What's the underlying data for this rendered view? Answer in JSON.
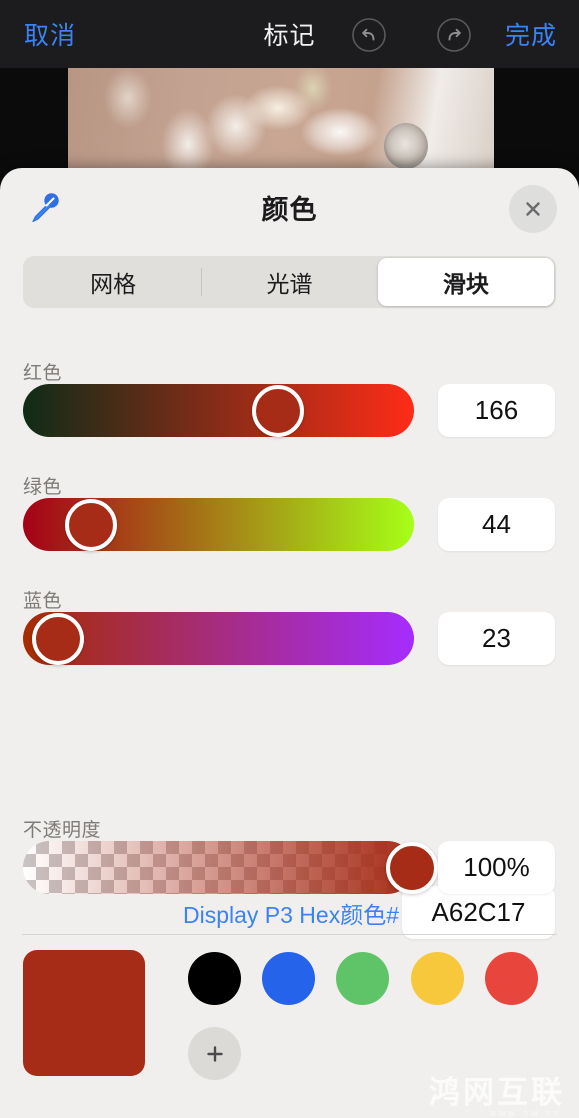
{
  "topbar": {
    "cancel_label": "取消",
    "title": "标记",
    "done_label": "完成",
    "undo_icon": "undo-arrow-icon",
    "redo_icon": "redo-arrow-icon"
  },
  "sheet": {
    "title": "颜色",
    "eyedropper_icon": "eyedropper-icon",
    "close_icon": "close-icon",
    "tabs": [
      {
        "label": "网格",
        "selected": false
      },
      {
        "label": "光谱",
        "selected": false
      },
      {
        "label": "滑块",
        "selected": true
      }
    ],
    "sliders": [
      {
        "name": "red",
        "label": "红色",
        "value": "166",
        "percent": 65.1,
        "gradient_from": "#0F2C17",
        "gradient_to": "#FF2C17"
      },
      {
        "name": "green",
        "label": "绿色",
        "value": "44",
        "percent": 17.3,
        "gradient_from": "#A60017",
        "gradient_to": "#A6FF17"
      },
      {
        "name": "blue",
        "label": "蓝色",
        "value": "23",
        "percent": 9.0,
        "gradient_from": "#A62C00",
        "gradient_to": "#A62CFF"
      }
    ],
    "hex": {
      "label": "Display P3 Hex颜色#",
      "value": "A62C17"
    },
    "opacity": {
      "label": "不透明度",
      "value": "100%",
      "percent": 100
    },
    "current_color": "#A62C17",
    "swatches": [
      {
        "name": "swatch-black",
        "color": "#000000"
      },
      {
        "name": "swatch-blue",
        "color": "#2563EB"
      },
      {
        "name": "swatch-green",
        "color": "#5FC467"
      },
      {
        "name": "swatch-yellow",
        "color": "#F7C83C"
      },
      {
        "name": "swatch-red",
        "color": "#E8453C"
      }
    ],
    "add_swatch_icon": "plus-icon"
  },
  "watermark": {
    "text": "鸿网互联",
    "subtext": "www.hw.cn"
  }
}
